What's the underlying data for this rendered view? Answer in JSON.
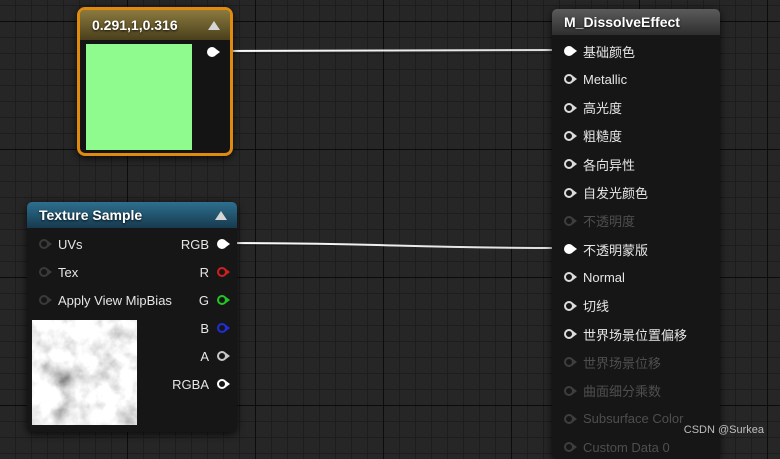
{
  "constant_node": {
    "title": "0.291,1,0.316",
    "color": "#8ffb8f",
    "accent": "#e08a10"
  },
  "texture_node": {
    "title": "Texture Sample",
    "inputs": [
      {
        "label": "UVs"
      },
      {
        "label": "Tex"
      },
      {
        "label": "Apply View MipBias"
      }
    ],
    "outputs": [
      {
        "label": "RGB",
        "color": "#ffffff"
      },
      {
        "label": "R",
        "color": "#d11f1f"
      },
      {
        "label": "G",
        "color": "#22c522"
      },
      {
        "label": "B",
        "color": "#1f2fd8"
      },
      {
        "label": "A",
        "color": "#c8c8c8"
      },
      {
        "label": "RGBA",
        "color": "#ffffff"
      }
    ]
  },
  "material_node": {
    "title": "M_DissolveEffect",
    "pins": [
      {
        "label": "基础颜色",
        "state": "connected"
      },
      {
        "label": "Metallic",
        "state": "enabled"
      },
      {
        "label": "高光度",
        "state": "enabled"
      },
      {
        "label": "粗糙度",
        "state": "enabled"
      },
      {
        "label": "各向异性",
        "state": "enabled"
      },
      {
        "label": "自发光颜色",
        "state": "enabled"
      },
      {
        "label": "不透明度",
        "state": "disabled"
      },
      {
        "label": "不透明蒙版",
        "state": "connected"
      },
      {
        "label": "Normal",
        "state": "enabled"
      },
      {
        "label": "切线",
        "state": "enabled"
      },
      {
        "label": "世界场景位置偏移",
        "state": "enabled"
      },
      {
        "label": "世界场景位移",
        "state": "disabled"
      },
      {
        "label": "曲面细分乘数",
        "state": "disabled"
      },
      {
        "label": "Subsurface Color",
        "state": "disabled"
      },
      {
        "label": "Custom Data 0",
        "state": "disabled"
      }
    ]
  },
  "watermark": "CSDN @Surkea"
}
